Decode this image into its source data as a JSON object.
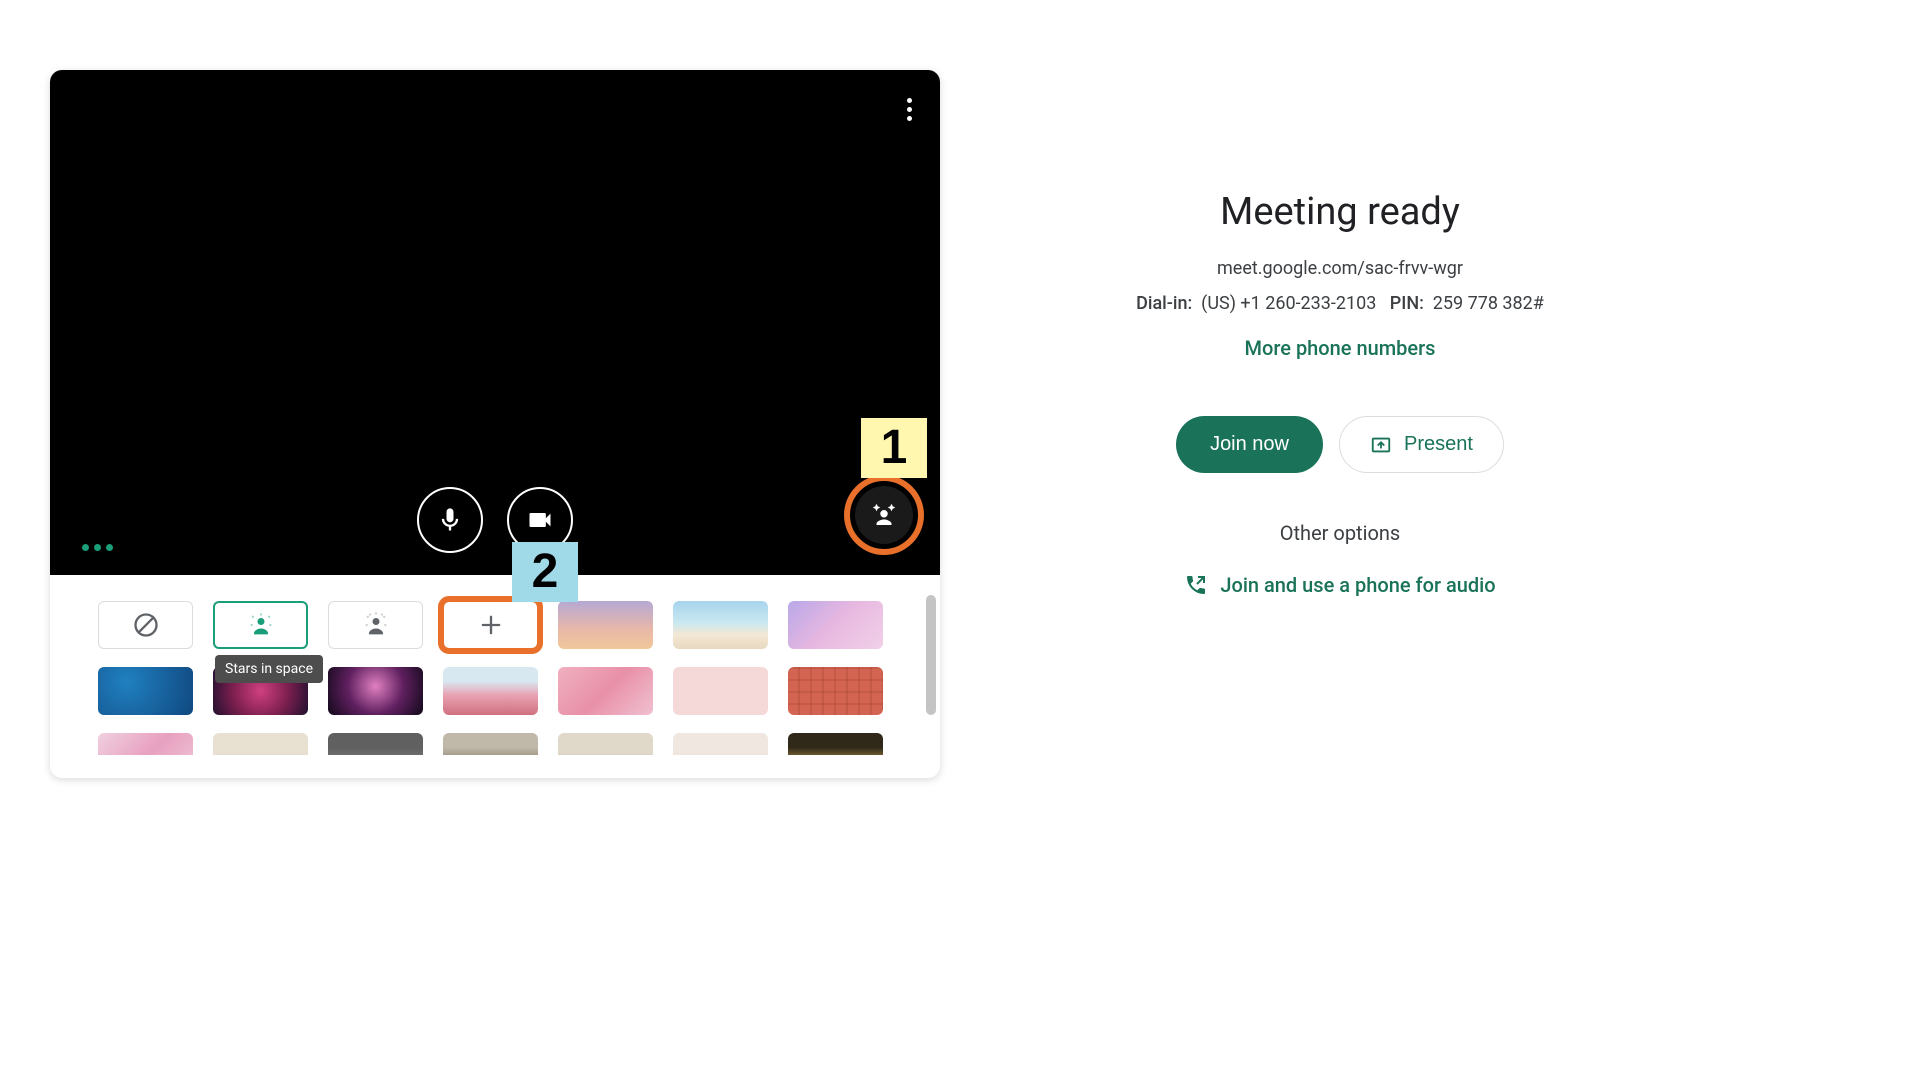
{
  "video": {
    "callout1": "1",
    "callout2": "2",
    "tooltip": "Stars in space"
  },
  "backgrounds": {
    "row1": [
      {
        "name": "none",
        "type": "icon"
      },
      {
        "name": "blur-slight",
        "type": "icon",
        "selected": true,
        "tooltip": true
      },
      {
        "name": "blur-strong",
        "type": "icon"
      },
      {
        "name": "add-custom",
        "type": "icon",
        "highlight": true
      },
      {
        "name": "sunset",
        "class": "bg-sunset"
      },
      {
        "name": "beach",
        "class": "bg-beach"
      },
      {
        "name": "clouds",
        "class": "bg-clouds"
      }
    ],
    "row2": [
      {
        "name": "water",
        "class": "bg-water"
      },
      {
        "name": "nebula",
        "class": "bg-nebula"
      },
      {
        "name": "fireworks",
        "class": "bg-fireworks"
      },
      {
        "name": "flowers",
        "class": "bg-flowers"
      },
      {
        "name": "pinkblur",
        "class": "bg-pinkblur"
      },
      {
        "name": "pinkstars",
        "class": "bg-pinkstars"
      },
      {
        "name": "pattern",
        "class": "bg-pattern"
      }
    ],
    "row3": [
      {
        "name": "confetti",
        "class": "bg-confetti"
      },
      {
        "name": "room1",
        "class": "bg-room1"
      },
      {
        "name": "room2",
        "class": "bg-room2"
      },
      {
        "name": "room3",
        "class": "bg-room3"
      },
      {
        "name": "room4",
        "class": "bg-room4"
      },
      {
        "name": "room5",
        "class": "bg-room5"
      },
      {
        "name": "room6",
        "class": "bg-room6"
      }
    ]
  },
  "right": {
    "title": "Meeting ready",
    "url": "meet.google.com/sac-frvv-wgr",
    "dialin_label": "Dial-in:",
    "dialin_number": "(US) +1 260-233-2103",
    "pin_label": "PIN:",
    "pin_value": "259 778 382#",
    "more_phone": "More phone numbers",
    "join_now": "Join now",
    "present": "Present",
    "other_options": "Other options",
    "phone_audio": "Join and use a phone for audio"
  }
}
